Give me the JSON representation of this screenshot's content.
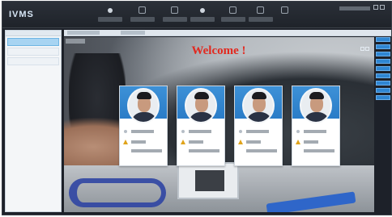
{
  "app": {
    "logo_text": "IVMS"
  },
  "toolbar": {
    "items": [
      {
        "icon": "main-view-icon"
      },
      {
        "icon": "remote-playback-icon"
      },
      {
        "icon": "event-center-icon"
      },
      {
        "icon": "device-management-icon"
      },
      {
        "icon": "face-library-icon"
      },
      {
        "icon": "configuration-icon"
      },
      {
        "icon": "monitor-icon"
      }
    ],
    "user": {
      "icon": "user-icon"
    }
  },
  "video": {
    "welcome_text": "Welcome !",
    "welcome_color": "#e2291f"
  },
  "cards": [
    {
      "icon": "warning-icon"
    },
    {
      "icon": "warning-icon"
    },
    {
      "icon": "warning-icon"
    },
    {
      "icon": "warning-icon"
    }
  ],
  "colors": {
    "card_header": "#2a7cc7",
    "selected_row": "#a7d4f2",
    "side_buttons": "#2f86d2"
  }
}
